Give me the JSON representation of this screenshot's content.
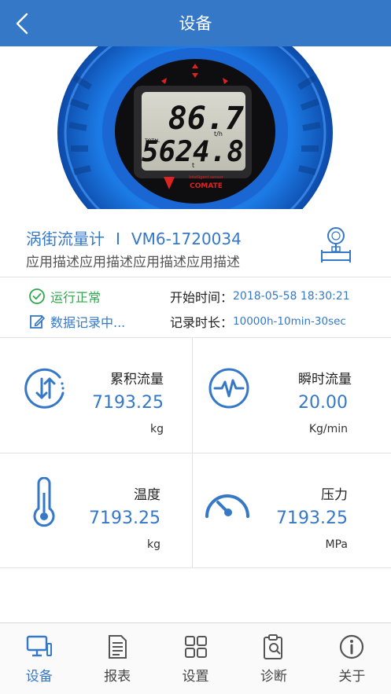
{
  "header": {
    "title": "设备",
    "back_icon": "chevron-left-icon"
  },
  "display": {
    "instant": "86.7",
    "instant_unit": "t/h",
    "total_label": "TOTAL",
    "total": "5624.8",
    "total_unit": "t",
    "brand": "COMATE",
    "brand_sub": "Intelligent sensor"
  },
  "device": {
    "name": "涡街流量计",
    "separator": "I",
    "model": "VM6-1720034",
    "description": "应用描述应用描述应用描述应用描述"
  },
  "status": {
    "running": "运行正常",
    "recording": "数据记录中...",
    "start_label": "开始时间：",
    "start_value": "2018-05-58 18:30:21",
    "duration_label": "记录时长：",
    "duration_value": "10000h-10min-30sec"
  },
  "metrics": [
    {
      "label": "累积流量",
      "value": "7193.25",
      "unit": "kg",
      "icon": "flow-arrows-icon"
    },
    {
      "label": "瞬时流量",
      "value": "20.00",
      "unit": "Kg/min",
      "icon": "pulse-icon"
    },
    {
      "label": "温度",
      "value": "7193.25",
      "unit": "kg",
      "icon": "thermometer-icon"
    },
    {
      "label": "压力",
      "value": "7193.25",
      "unit": "MPa",
      "icon": "gauge-icon"
    }
  ],
  "tabs": [
    {
      "label": "设备",
      "icon": "monitor-icon",
      "active": true
    },
    {
      "label": "报表",
      "icon": "report-icon",
      "active": false
    },
    {
      "label": "设置",
      "icon": "grid-icon",
      "active": false
    },
    {
      "label": "诊断",
      "icon": "clipboard-search-icon",
      "active": false
    },
    {
      "label": "关于",
      "icon": "info-icon",
      "active": false
    }
  ],
  "colors": {
    "primary": "#3578c8",
    "success": "#2ea84a"
  }
}
